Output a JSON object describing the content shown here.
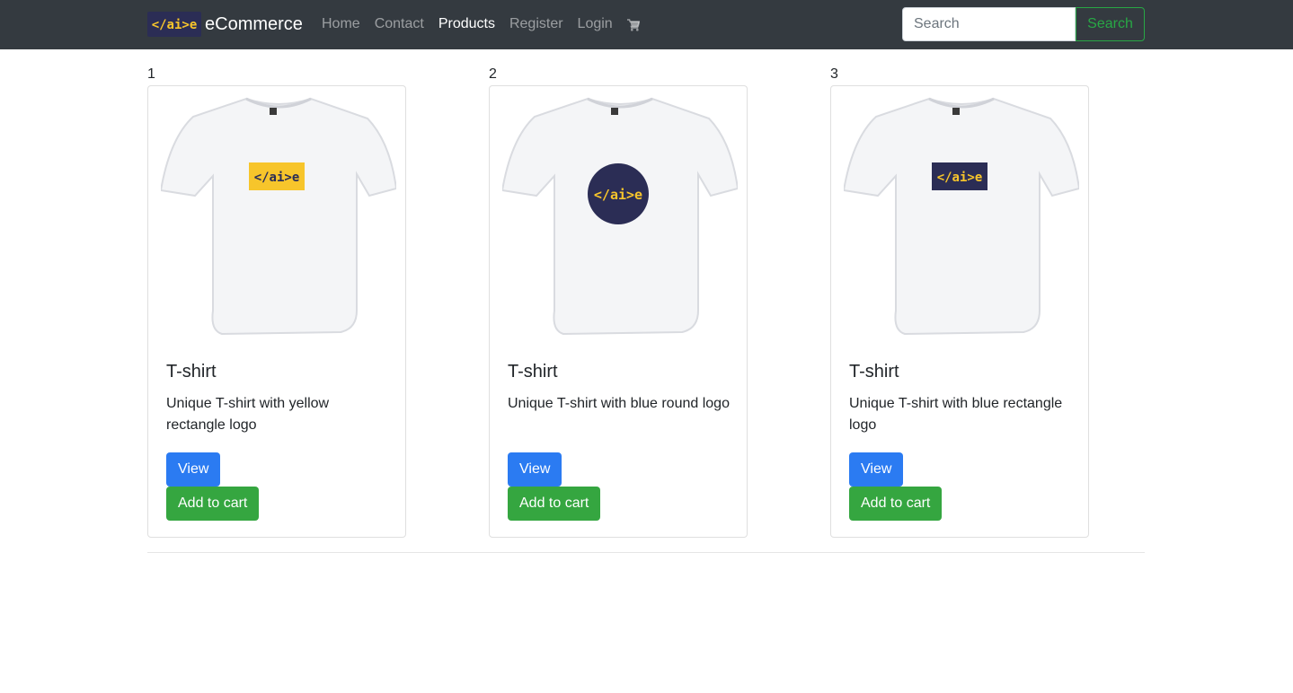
{
  "navbar": {
    "brand_name": "eCommerce",
    "logo_text": "</ai>e",
    "links": [
      {
        "label": "Home",
        "active": false
      },
      {
        "label": "Contact",
        "active": false
      },
      {
        "label": "Products",
        "active": true
      },
      {
        "label": "Register",
        "active": false
      },
      {
        "label": "Login",
        "active": false
      }
    ],
    "cart_icon": "shopping-cart-icon",
    "search": {
      "placeholder": "Search",
      "value": "",
      "button_label": "Search"
    }
  },
  "products": [
    {
      "index": "1",
      "title": "T-shirt",
      "description": "Unique T-shirt with yellow rectangle logo",
      "logo_style": "yellow-rectangle",
      "view_label": "View",
      "cart_label": "Add to cart"
    },
    {
      "index": "2",
      "title": "T-shirt",
      "description": "Unique T-shirt with blue round logo",
      "logo_style": "blue-round",
      "view_label": "View",
      "cart_label": "Add to cart"
    },
    {
      "index": "3",
      "title": "T-shirt",
      "description": "Unique T-shirt with blue rectangle logo",
      "logo_style": "blue-rectangle",
      "view_label": "View",
      "cart_label": "Add to cart"
    }
  ],
  "colors": {
    "navbar_bg": "#343a40",
    "primary": "#2b7bf2",
    "success": "#35a640",
    "logo_navy": "#2b2d55",
    "logo_yellow": "#f7c52b"
  }
}
